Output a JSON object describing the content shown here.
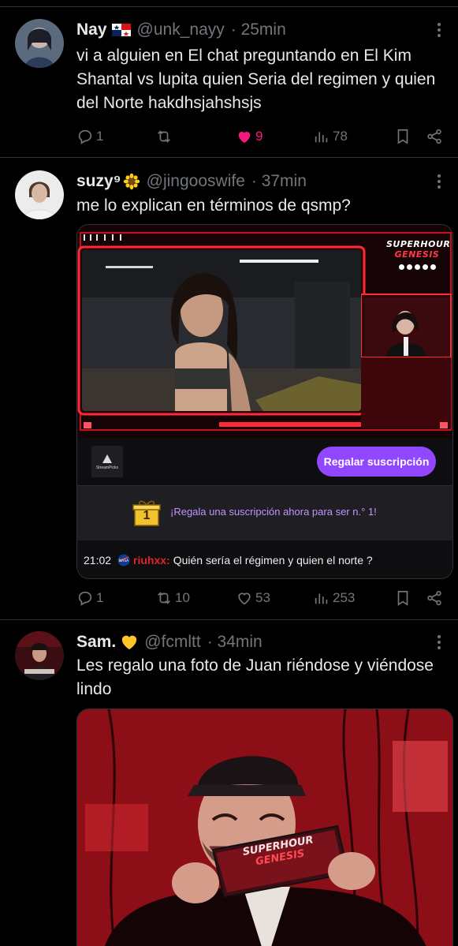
{
  "tweets": [
    {
      "name": "Nay",
      "handle": "@unk_nayy",
      "time": "· 25min",
      "text": "vi a alguien en El chat preguntando en El Kim Shantal vs lupita quien Seria del regimen y quien del Norte hakdhsjahshsjs",
      "replies": "1",
      "retweets": "",
      "likes": "9",
      "views": "78"
    },
    {
      "name": "suzy⁹",
      "handle": "@jingooswife",
      "time": "· 37min",
      "text": "me lo explican en términos de qsmp?",
      "replies": "1",
      "retweets": "10",
      "likes": "53",
      "views": "253",
      "stream": {
        "overlay_logo_line1": "SUPERHOUR",
        "overlay_logo_line2": "GENESIS",
        "channel_logo": "StreamPicks",
        "gift_button": "Regalar suscripción",
        "gift_banner_badge": "1",
        "gift_banner": "¡Regala una suscripción ahora para ser n.° 1!",
        "chat_time": "21:02",
        "chat_user": "riuhxx:",
        "chat_message": "Quién sería el régimen y quien el norte ?"
      }
    },
    {
      "name": "Sam.",
      "handle": "@fcmltt",
      "time": "· 34min",
      "text": "Les regalo una foto de Juan riéndose y viéndose lindo",
      "photo_card_line1": "SUPERHOUR",
      "photo_card_line2": "GENESIS"
    }
  ],
  "colors": {
    "background": "#000000",
    "text": "#e7e9ea",
    "muted": "#71767b",
    "like": "#f91880",
    "twitch_purple": "#9147ff",
    "chat_user": "#e0242a"
  },
  "icons": [
    "reply-icon",
    "retweet-icon",
    "heart-icon",
    "views-icon",
    "bookmark-icon",
    "share-icon",
    "more-icon",
    "panama-flag-icon",
    "sunflower-icon",
    "yellow-heart-icon",
    "gift-icon",
    "nasa-badge-icon"
  ]
}
